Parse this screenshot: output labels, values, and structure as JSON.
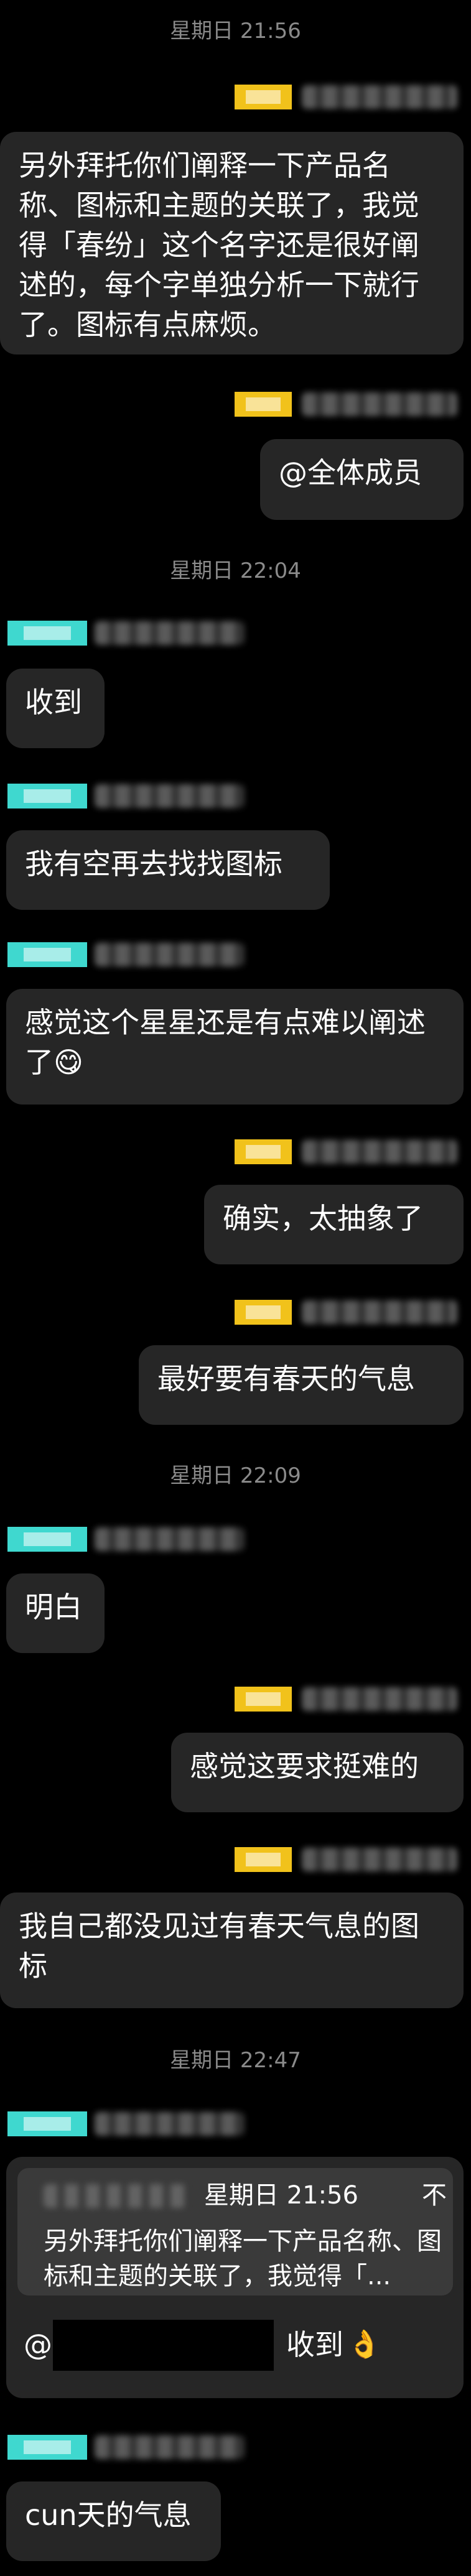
{
  "timestamps": [
    "星期日 21:56",
    "星期日 22:04",
    "星期日 22:09",
    "星期日 22:47"
  ],
  "messages": {
    "m1": "另外拜托你们阐释一下产品名称、图标和主题的关联了，我觉得「春纷」这个名字还是很好阐述的，每个字单独分析一下就行了。图标有点麻烦。",
    "m2": "@全体成员",
    "m3": "收到",
    "m4": "我有空再去找找图标",
    "m5": "感觉这个星星还是有点难以阐述了",
    "m6": "确实，太抽象了",
    "m7": "最好要有春天的气息",
    "m8": "明白",
    "m9": "感觉这要求挺难的",
    "m10": "我自己都没见过有春天气息的图标",
    "m12": "cun天的气息"
  },
  "emoji": {
    "m5": "😋",
    "m11": "👌"
  },
  "quote": {
    "time": "星期日 21:56",
    "close": "不",
    "text": "另外拜托你们阐释一下产品名称、图标和主题的关联了，我觉得「..."
  },
  "reply": {
    "at": "@",
    "text": "收到"
  },
  "colors": {
    "bubble": "#262626",
    "avatar_yellow": "#f1c21b",
    "avatar_cyan": "#3fd8cf",
    "timestamp": "#8a8a8a"
  }
}
